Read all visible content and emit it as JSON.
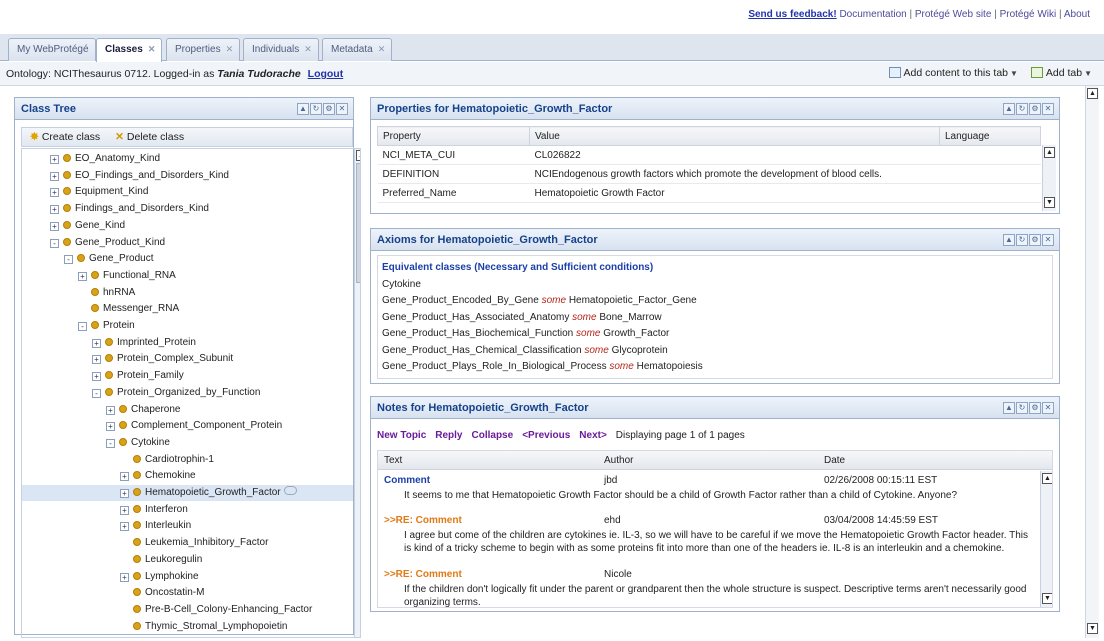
{
  "toplinks": {
    "feedback": "Send us feedback!",
    "links": [
      "Documentation",
      "Protégé Web site",
      "Protégé Wiki",
      "About"
    ]
  },
  "tabs": [
    {
      "label": "My WebProtégé",
      "closable": false,
      "active": false
    },
    {
      "label": "Classes",
      "closable": true,
      "active": true
    },
    {
      "label": "Properties",
      "closable": true,
      "active": false
    },
    {
      "label": "Individuals",
      "closable": true,
      "active": false
    },
    {
      "label": "Metadata",
      "closable": true,
      "active": false
    }
  ],
  "ontology_bar": {
    "prefix": "Ontology: NCIThesaurus 0712. Logged-in as",
    "user": "Tania Tudorache",
    "logout": "Logout",
    "add_content": "Add content to this tab",
    "add_tab": "Add tab"
  },
  "class_tree": {
    "title": "Class Tree",
    "create": "Create class",
    "delete": "Delete class",
    "nodes": [
      {
        "label": "EO_Anatomy_Kind",
        "level": 0,
        "toggle": "+"
      },
      {
        "label": "EO_Findings_and_Disorders_Kind",
        "level": 0,
        "toggle": "+"
      },
      {
        "label": "Equipment_Kind",
        "level": 0,
        "toggle": "+"
      },
      {
        "label": "Findings_and_Disorders_Kind",
        "level": 0,
        "toggle": "+"
      },
      {
        "label": "Gene_Kind",
        "level": 0,
        "toggle": "+"
      },
      {
        "label": "Gene_Product_Kind",
        "level": 0,
        "toggle": "-"
      },
      {
        "label": "Gene_Product",
        "level": 1,
        "toggle": "-"
      },
      {
        "label": "Functional_RNA",
        "level": 2,
        "toggle": "+"
      },
      {
        "label": "hnRNA",
        "level": 2,
        "toggle": ""
      },
      {
        "label": "Messenger_RNA",
        "level": 2,
        "toggle": ""
      },
      {
        "label": "Protein",
        "level": 2,
        "toggle": "-"
      },
      {
        "label": "Imprinted_Protein",
        "level": 3,
        "toggle": "+"
      },
      {
        "label": "Protein_Complex_Subunit",
        "level": 3,
        "toggle": "+"
      },
      {
        "label": "Protein_Family",
        "level": 3,
        "toggle": "+"
      },
      {
        "label": "Protein_Organized_by_Function",
        "level": 3,
        "toggle": "-"
      },
      {
        "label": "Chaperone",
        "level": 4,
        "toggle": "+"
      },
      {
        "label": "Complement_Component_Protein",
        "level": 4,
        "toggle": "+"
      },
      {
        "label": "Cytokine",
        "level": 4,
        "toggle": "-"
      },
      {
        "label": "Cardiotrophin-1",
        "level": 5,
        "toggle": ""
      },
      {
        "label": "Chemokine",
        "level": 5,
        "toggle": "+"
      },
      {
        "label": "Hematopoietic_Growth_Factor",
        "level": 5,
        "toggle": "+",
        "selected": true
      },
      {
        "label": "Interferon",
        "level": 5,
        "toggle": "+"
      },
      {
        "label": "Interleukin",
        "level": 5,
        "toggle": "+"
      },
      {
        "label": "Leukemia_Inhibitory_Factor",
        "level": 5,
        "toggle": ""
      },
      {
        "label": "Leukoregulin",
        "level": 5,
        "toggle": ""
      },
      {
        "label": "Lymphokine",
        "level": 5,
        "toggle": "+"
      },
      {
        "label": "Oncostatin-M",
        "level": 5,
        "toggle": ""
      },
      {
        "label": "Pre-B-Cell_Colony-Enhancing_Factor",
        "level": 5,
        "toggle": ""
      },
      {
        "label": "Thymic_Stromal_Lymphopoietin",
        "level": 5,
        "toggle": ""
      }
    ]
  },
  "properties": {
    "title": "Properties for Hematopoietic_Growth_Factor",
    "columns": [
      "Property",
      "Value",
      "Language"
    ],
    "rows": [
      {
        "property": "NCI_META_CUI",
        "value": "CL026822",
        "language": ""
      },
      {
        "property": "DEFINITION",
        "value": "NCIEndogenous growth factors which promote the development of blood cells.",
        "language": ""
      },
      {
        "property": "Preferred_Name",
        "value": "Hematopoietic Growth Factor",
        "language": ""
      }
    ]
  },
  "axioms": {
    "title": "Axioms for Hematopoietic_Growth_Factor",
    "heading": "Equivalent classes (Necessary and Sufficient conditions)",
    "lines": [
      {
        "pre": "Cytokine",
        "kw": "",
        "post": ""
      },
      {
        "pre": "Gene_Product_Encoded_By_Gene",
        "kw": "some",
        "post": "Hematopoietic_Factor_Gene"
      },
      {
        "pre": "Gene_Product_Has_Associated_Anatomy",
        "kw": "some",
        "post": "Bone_Marrow"
      },
      {
        "pre": "Gene_Product_Has_Biochemical_Function",
        "kw": "some",
        "post": "Growth_Factor"
      },
      {
        "pre": "Gene_Product_Has_Chemical_Classification",
        "kw": "some",
        "post": "Glycoprotein"
      },
      {
        "pre": "Gene_Product_Plays_Role_In_Biological_Process",
        "kw": "some",
        "post": "Hematopoiesis"
      }
    ]
  },
  "notes": {
    "title": "Notes for Hematopoietic_Growth_Factor",
    "nav": [
      "New Topic",
      "Reply",
      "Collapse",
      "<Previous",
      "Next>"
    ],
    "page_info": "Displaying page 1 of 1 pages",
    "columns": [
      "Text",
      "Author",
      "Date"
    ],
    "items": [
      {
        "head": "Comment",
        "author": "jbd",
        "date": "02/26/2008 00:15:11 EST",
        "body": "It seems to me that Hematopoietic Growth Factor should be a child of Growth Factor rather than a child of Cytokine. Anyone?"
      },
      {
        "head": ">>RE: Comment",
        "author": "ehd",
        "date": "03/04/2008 14:45:59 EST",
        "body": "I agree but come of the children are cytokines ie. IL-3, so we will have to be careful if we move the Hematopoietic Growth Factor header. This is kind of a tricky scheme to begin with as some proteins fit into more than one of the headers ie. IL-8 is an interleukin and a chemokine."
      },
      {
        "head": ">>RE: Comment",
        "author": "Nicole",
        "date": "",
        "body": "If the children don't logically fit under the parent or grandparent then the whole structure is suspect. Descriptive terms aren't necessarily good organizing terms."
      }
    ]
  },
  "colors": {
    "accent": "#15428b",
    "link": "#2233aa",
    "keyword": "#b3261e",
    "reply": "#e07a14"
  }
}
